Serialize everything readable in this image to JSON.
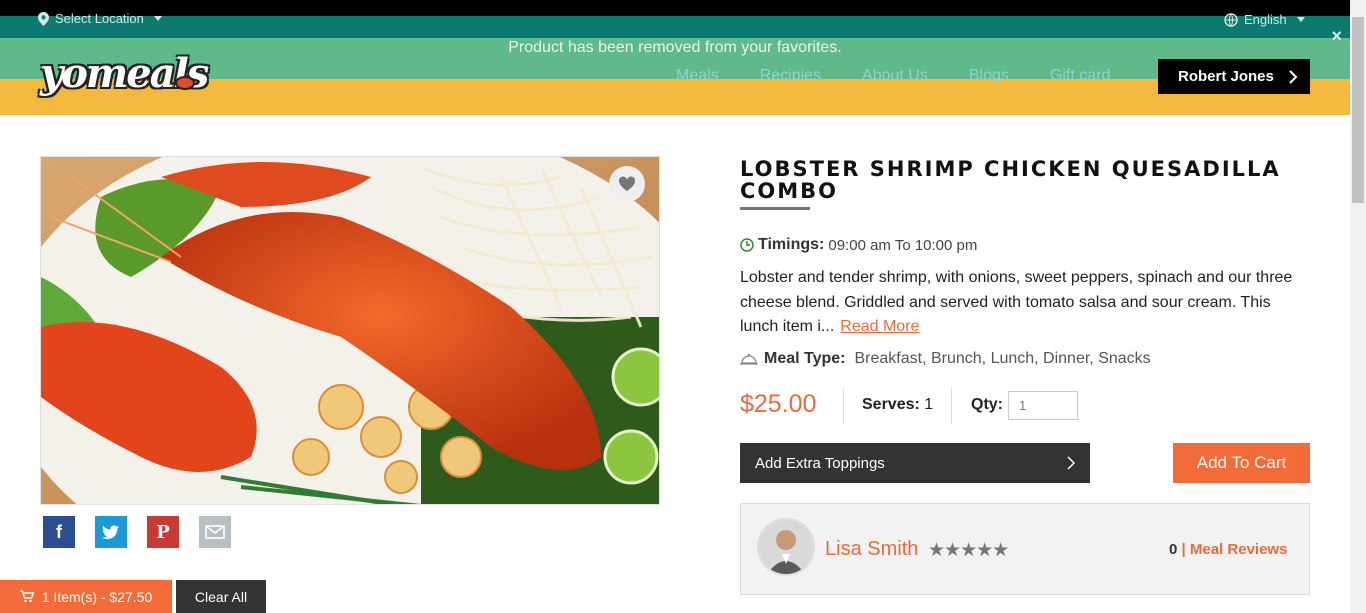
{
  "topbar": {
    "location_label": "Select Location",
    "language_label": "English"
  },
  "notice": {
    "message": "Product has been removed from your favorites.",
    "close_symbol": "×"
  },
  "brand": {
    "logo_text": "yomeals"
  },
  "nav": {
    "items": [
      "Meals",
      "Recipies",
      "About Us",
      "Blogs",
      "Gift card"
    ]
  },
  "user": {
    "name": "Robert Jones"
  },
  "product": {
    "title": "LOBSTER SHRIMP CHICKEN QUESADILLA COMBO",
    "timings_label": "Timings:",
    "timings_value": "09:00 am To 10:00 pm",
    "description": "Lobster and tender shrimp, with onions, sweet peppers, spinach and our three cheese blend. Griddled and served with tomato salsa and sour cream. This lunch item i...",
    "read_more": "Read More",
    "meal_type_label": "Meal Type:",
    "meal_type_value": "Breakfast, Brunch, Lunch, Dinner, Snacks",
    "price": "$25.00",
    "serves_label": "Serves:",
    "serves_value": "1",
    "qty_label": "Qty:",
    "qty_placeholder": "1",
    "toppings_label": "Add Extra Toppings",
    "add_to_cart_label": "Add To Cart"
  },
  "chef": {
    "name": "Lisa Smith",
    "rating": 0,
    "review_count": "0",
    "reviews_label": "Meal Reviews"
  },
  "cart": {
    "summary": "1 Item(s) - $27.50",
    "clear_label": "Clear All"
  },
  "colors": {
    "accent": "#f26b38",
    "header": "#f3b93f",
    "teal": "#0c7a6f",
    "notice": "#5fb98a"
  }
}
